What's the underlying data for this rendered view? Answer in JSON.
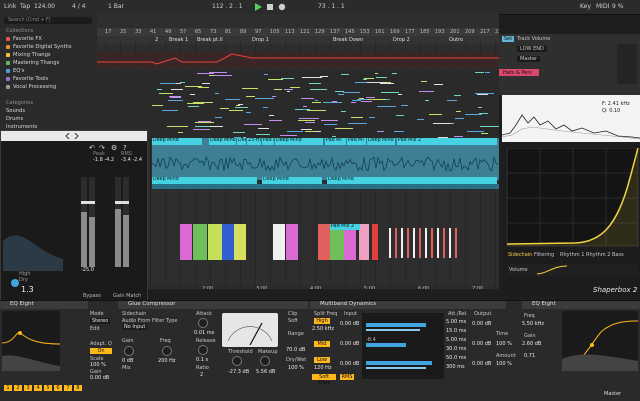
{
  "top_bar": {
    "link": "Link",
    "tap": "Tap",
    "tempo": "124.00",
    "signature": "4 / 4",
    "quantize": "1 Bar",
    "position": "112 .  2 .  1",
    "loop_start": "73 .  1 .  1",
    "key": "Key",
    "midi": "MIDI",
    "cpu": "9 %"
  },
  "browser": {
    "search_placeholder": "Search (Cmd + F)",
    "collections_header": "Collections",
    "collections": [
      {
        "label": "Favorite FX",
        "color": "#e8554e"
      },
      {
        "label": "Favorite Digital Synths",
        "color": "#f08a2c"
      },
      {
        "label": "Mixing Thangs",
        "color": "#f1c232"
      },
      {
        "label": "Mastering Thangs",
        "color": "#5fb85f"
      },
      {
        "label": "EQ's",
        "color": "#4aa3df"
      },
      {
        "label": "Favorite Tools",
        "color": "#9b6fd1"
      },
      {
        "label": "Vocal Processing",
        "color": "#999999"
      }
    ],
    "categories_header": "Categories",
    "categories": [
      "Sounds",
      "Drums",
      "Instruments"
    ]
  },
  "arrangement": {
    "bar_numbers": [
      "17",
      "25",
      "33",
      "41",
      "49",
      "57",
      "65",
      "73",
      "81",
      "89",
      "97",
      "105",
      "113",
      "121",
      "129",
      "137",
      "145",
      "153",
      "161",
      "169",
      "177",
      "185",
      "193",
      "201",
      "209",
      "217",
      "225"
    ],
    "locators": [
      "2",
      "Break 1",
      "Break pt.II",
      "Drop 1",
      "Break Down",
      "Drop 2",
      "Outro"
    ],
    "time_labels": [
      "2:00",
      "3:00",
      "4:00",
      "5:00",
      "6:00",
      "7:00"
    ],
    "audio_clips_top": [
      "Deep Mind",
      "Deep Mind",
      "Deep Mind",
      "23-Ha",
      "Pad M",
      "Deep Mind",
      "Pad Mi",
      "Pad Mi",
      "Deep Mind",
      "Pad Mix 2"
    ],
    "audio_clips_bottom": [
      "Deep Mind",
      "Deep Mind",
      "Deep Mind"
    ],
    "pad_clip_label": "Pad Mix 2"
  },
  "right_panel": {
    "track_volume_label": "Track Volume",
    "low_end": "LOW END",
    "master": "Master",
    "hats_perc": "Hats & Perc",
    "set_label": "Set"
  },
  "spectrum": {
    "freq": "F: 2.41 kHz",
    "gain": "Q: 0.10"
  },
  "shaper": {
    "tabs": [
      "Sidechain",
      "Filtering",
      "Rhythm 1",
      "Rhythm 2",
      "Bass"
    ],
    "title": "Shaperbox 2",
    "volume_label": "Volume"
  },
  "plugin_window": {
    "meter_left": "-1.8  -4.2",
    "meter_right": "-3.4  -2.4",
    "peak_label": "Peak",
    "rms_label": "RMS",
    "low_level": "-25.0",
    "readout": "1.3",
    "high_label": "High",
    "dry_label": "Dry",
    "buttons": [
      "Bypass",
      "Gain Match"
    ]
  },
  "devices": {
    "eq_title": "EQ Eight",
    "glue_title": "Glue Compressor",
    "multiband_title": "Multiband Dynamics",
    "eq2_title": "EQ Eight",
    "sidechain": "Sidechain",
    "audio_from": "Audio From",
    "no_input": "No Input",
    "mode_label": "Mode",
    "mode_value": "Stereo",
    "edit": "Edit",
    "adapt_q": "Adapt. Q",
    "scale": "Scale",
    "scale_value": "100 %",
    "gain_label": "Gain",
    "gain_value": "0.00 dB",
    "attack": "Attack",
    "attack_value": "0.01 ms",
    "release": "Release",
    "release_value": "0.1 s",
    "ratio": "Ratio",
    "ratio_value": "2",
    "threshold": "Threshold",
    "threshold_value": "-27.3 dB",
    "makeup": "Makeup",
    "makeup_value": "5.56 dB",
    "range": "Range",
    "range_value": "70.0 dB",
    "dry_wet": "Dry/Wet",
    "dry_wet_value": "100 %",
    "clip": "Clip",
    "soft": "Soft",
    "filter_type": "Filter Type",
    "freq": "Freq",
    "freq_value": "200 Hz",
    "gain_value2": "0 dB",
    "mix": "Mix",
    "split_freq": "Split Freq",
    "high": "High",
    "high_freq": "2.50 kHz",
    "mid": "Mid",
    "low": "Low",
    "low_freq": "120 Hz",
    "soft_knee": "Soft Knee",
    "rms": "RMS",
    "input": "Input",
    "input_values": [
      "0.00 dB",
      "0.00 dB",
      "0.00 dB"
    ],
    "atk_rel": "Att./Rel.",
    "atk_values": [
      "5.00 ms",
      "15.0 ms",
      "5.00 ms",
      "30.0 ms",
      "50.0 ms",
      "300 ms"
    ],
    "output": "Output",
    "output_values": [
      "0.00 dB",
      "0.00 dB",
      "0.00 dB"
    ],
    "time": "Time",
    "time_value": "100 %",
    "amount": "Amount",
    "amount_value": "100 %",
    "multiband_meter_values": [
      "-8.4",
      "-5.6"
    ],
    "eq_right_freq": "5.50 kHz",
    "eq_right_gain": "2.60 dB",
    "eq_right_q": "0.71",
    "master_label": "Master"
  },
  "colors": {
    "accent": "#ffb81c",
    "clip_cyan": "#39d0de",
    "clip_red": "#d9423a",
    "clip_green": "#6cb84a"
  }
}
